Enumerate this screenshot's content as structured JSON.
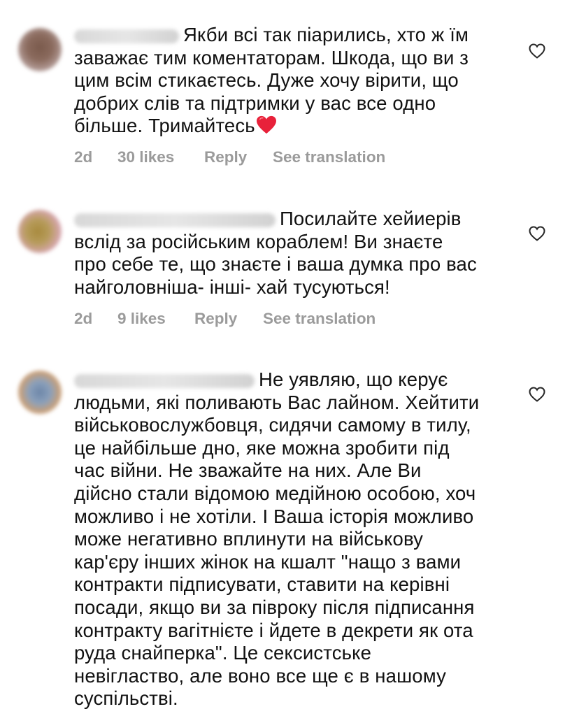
{
  "comments": [
    {
      "lines": [
        "Якби всі так піарились, хто ж їм",
        "заважає тим коментаторам. Шкода, що ви з",
        "цим всім стикаєтесь. Дуже хочу вірити, що",
        "добрих слів та підтримки у вас все одно",
        "більше. Тримайтесь"
      ],
      "emoji": "red-heart",
      "time": "2d",
      "likes": "30 likes",
      "reply": "Reply",
      "translate": "See translation"
    },
    {
      "lines": [
        "Посилайте хейиерів",
        "вслід за російським кораблем!  Ви знаєте",
        "про себе те, що знаєте і ваша думка про вас",
        "найголовніша- інші- хай тусуються!"
      ],
      "time": "2d",
      "likes": "9 likes",
      "reply": "Reply",
      "translate": "See translation"
    },
    {
      "lines": [
        "Не уявляю, що керує",
        "людьми, які поливають Вас лайном. Хейтити",
        "військовослужбовця, сидячи самому в тилу,",
        "це найбільше дно, яке можна зробити під",
        "час війни. Не зважайте на них. Але Ви",
        "дійсно стали відомою медійною особою, хоч",
        "можливо і не хотіли. І Ваша історія  можливо",
        "може негативно вплинути на військову",
        "кар'єру інших жінок на кшалт \"нащо з вами",
        "контракти підписувати, ставити на керівні",
        "посади, якщо ви за півроку після підписання",
        "контракту вагітнієте і йдете в декрети як ота",
        "руда снайперка\". Це сексистське",
        "невігластво, але воно все ще є в нашому",
        "суспільстві."
      ]
    }
  ],
  "icons": {
    "like": "heart-outline-icon",
    "emoji": "red-heart-emoji"
  },
  "colors": {
    "text": "#111111",
    "meta": "#9b9b9b",
    "heart": "#e8213a"
  }
}
